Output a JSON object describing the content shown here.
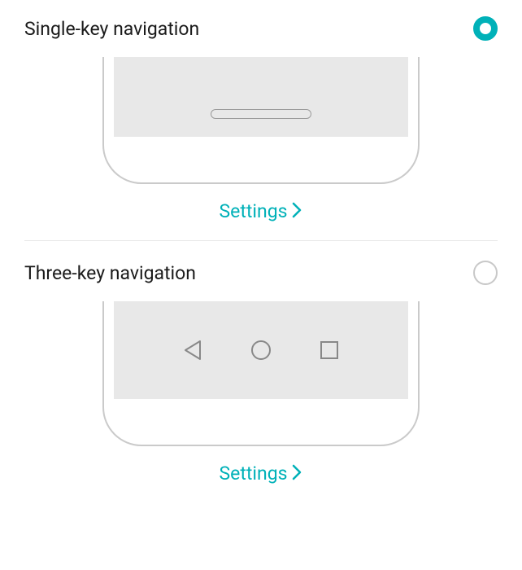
{
  "options": [
    {
      "label": "Single-key navigation",
      "settings_label": "Settings",
      "selected": true
    },
    {
      "label": "Three-key navigation",
      "settings_label": "Settings",
      "selected": false
    }
  ],
  "accent_color": "#00b1b8"
}
